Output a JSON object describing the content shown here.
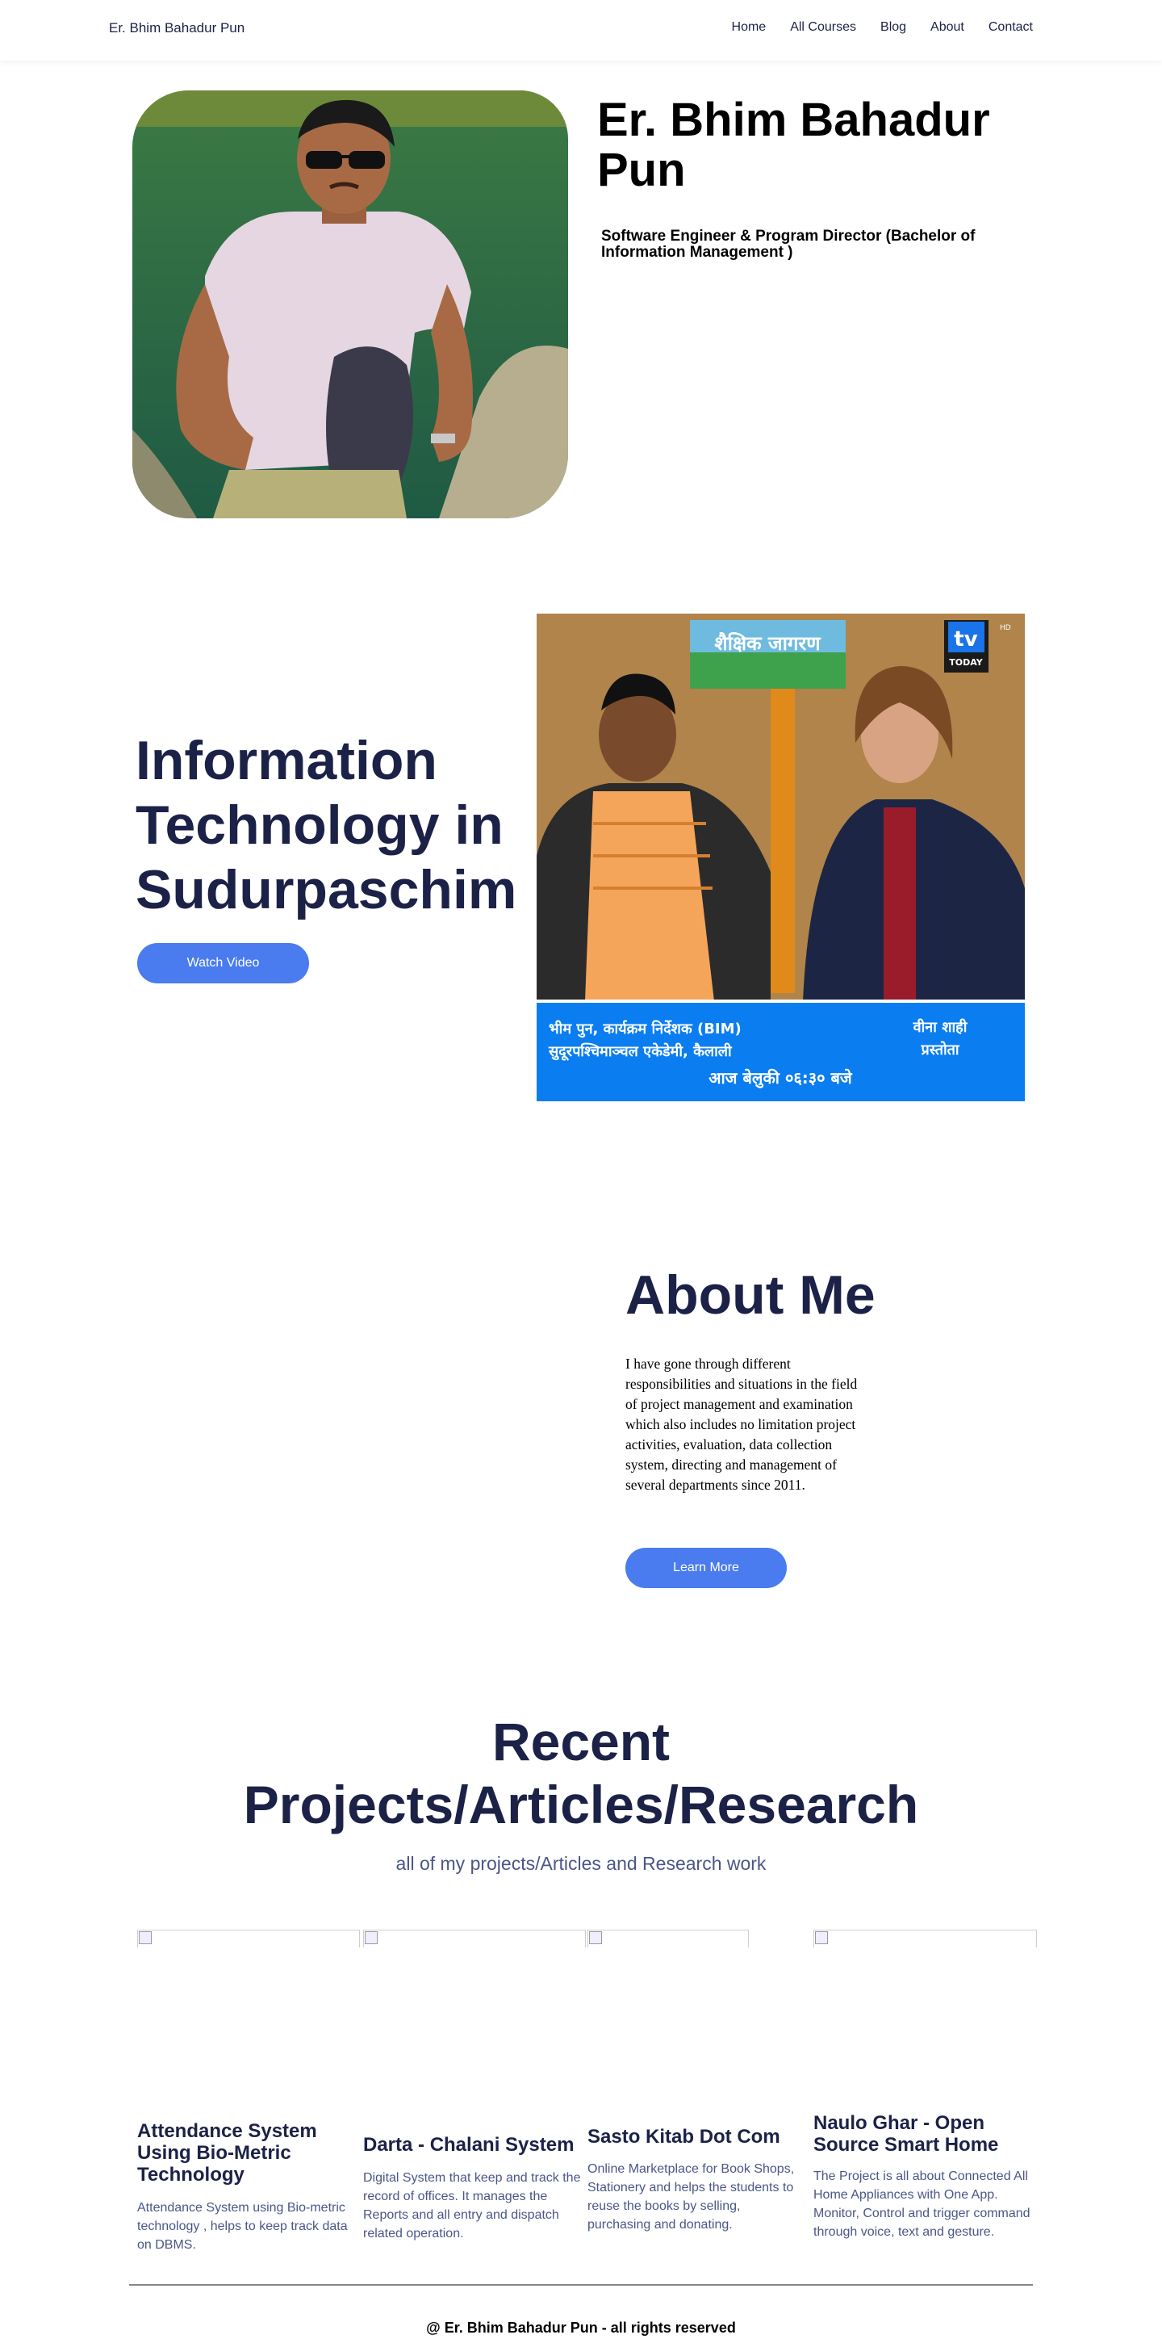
{
  "nav": {
    "brand": "Er. Bhim Bahadur Pun",
    "links": [
      "Home",
      "All Courses",
      "Blog",
      "About",
      "Contact"
    ]
  },
  "hero": {
    "title": "Er. Bhim Bahadur Pun",
    "subtitle": "Software Engineer & Program Director (Bachelor of Information Management )"
  },
  "video": {
    "title": "Information Technology in Sudurpaschim",
    "button": "Watch Video",
    "thumb_logo": "शैक्षिक जागरण",
    "thumb_channel": "tv",
    "thumb_channel_sub": "TODAY",
    "thumb_hd": "HD",
    "thumb_line1": "भीम पुन, कार्यक्रम निर्देशक (BIM)",
    "thumb_line2": "सुदूरपश्चिमाञ्चल एकेडेमी, कैलाली",
    "thumb_host": "वीना शाही",
    "thumb_host_role": "प्रस्तोता",
    "thumb_time": "आज बेलुकी ०६:३० बजे"
  },
  "about": {
    "title": "About Me",
    "text": "I have gone through different responsibilities and situations in the field of project management and examination which also includes no limitation project activities, evaluation, data collection system, directing and management of several departments since 2011.",
    "button": "Learn More"
  },
  "projects": {
    "title": "Recent Projects/Articles/Research",
    "subtitle": "all of my projects/Articles and Research work",
    "items": [
      {
        "title": "Attendance System Using Bio-Metric Technology",
        "desc": "Attendance System using Bio-metric technology , helps to keep track data on DBMS."
      },
      {
        "title": "Darta - Chalani System",
        "desc": "Digital System that keep and track the record of offices. It manages the Reports and all entry and dispatch related operation."
      },
      {
        "title": "Sasto Kitab Dot Com",
        "desc": "Online Marketplace for Book Shops, Stationery and helps the students to reuse the books by selling, purchasing and donating."
      },
      {
        "title": "Naulo Ghar - Open Source Smart Home",
        "desc": "The Project is all about Connected All Home Appliances with One App. Monitor, Control and trigger command through voice, text and gesture."
      }
    ]
  },
  "footer": {
    "text": "@ Er. Bhim Bahadur Pun - all rights reserved"
  },
  "colors": {
    "primary_dark": "#1c2147",
    "accent_blue": "#4a7cf0",
    "muted_text": "#4a5688"
  }
}
